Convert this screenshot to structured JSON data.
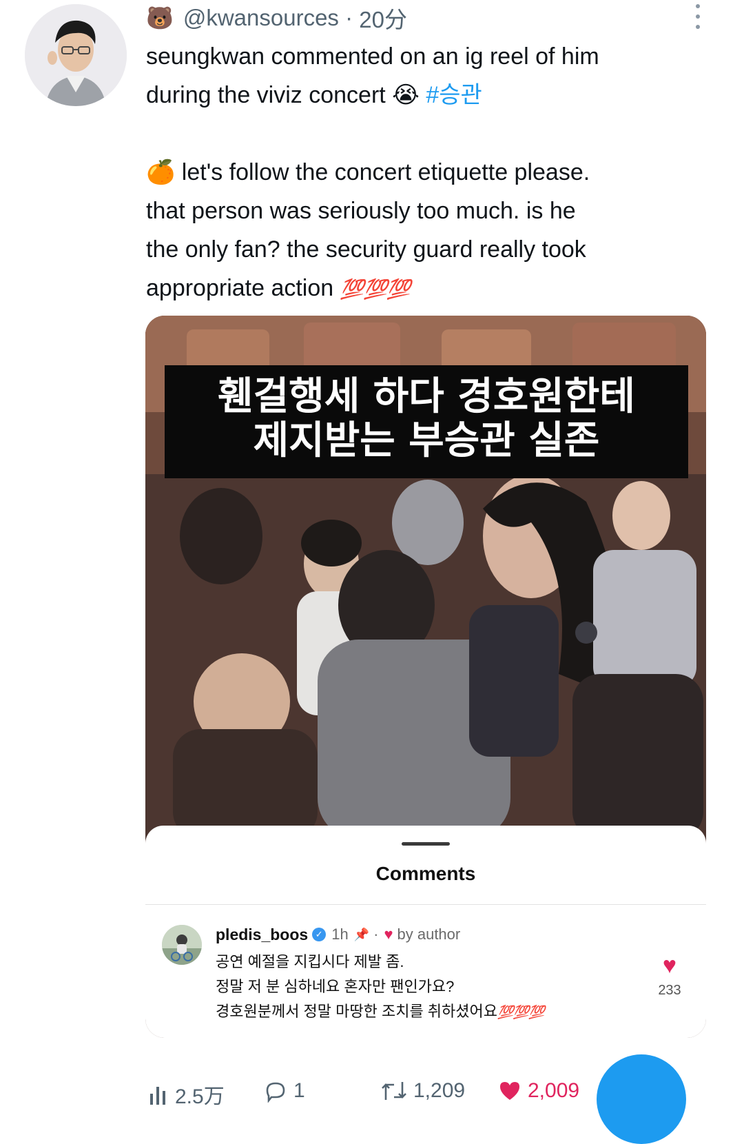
{
  "tweet": {
    "author_emoji": "🐻",
    "handle": "@kwansources",
    "separator": " · ",
    "time": "20分",
    "text_line1": "seungkwan commented on an ig reel of him",
    "text_line2_prefix": "during the viviz concert ",
    "crying_emoji": "😭",
    "hashtag": "#승관",
    "translation_emoji": "🍊",
    "translation_line1": " let's follow the concert etiquette please.",
    "translation_line2": "that person was seriously too much. is he",
    "translation_line3": "the only fan? the security guard really took",
    "translation_line4_prefix": "appropriate action ",
    "hundred_emojis": "💯💯💯"
  },
  "media": {
    "caption_line1": "휀걸행세 하다 경호원한테",
    "caption_line2": "제지받는 부승관 실존",
    "comments_title": "Comments",
    "comment": {
      "username": "pledis_boos",
      "verified_mark": "✓",
      "time": "1h",
      "pin_icon": "📌",
      "by_author": "by author",
      "line1": "공연 예절을 지킵시다 제발 좀.",
      "line2": "정말 저 분 심하네요 혼자만 팬인가요?",
      "line3": "경호원분께서 정말 마땅한 조치를 취하셨어요",
      "line3_emojis": "💯💯💯",
      "likes": "233"
    }
  },
  "actions": {
    "views": "2.5万",
    "replies": "1",
    "retweets": "1,209",
    "likes": "2,009"
  },
  "colors": {
    "accent": "#1d9bf0",
    "like": "#e0245e",
    "muted": "#536471"
  }
}
